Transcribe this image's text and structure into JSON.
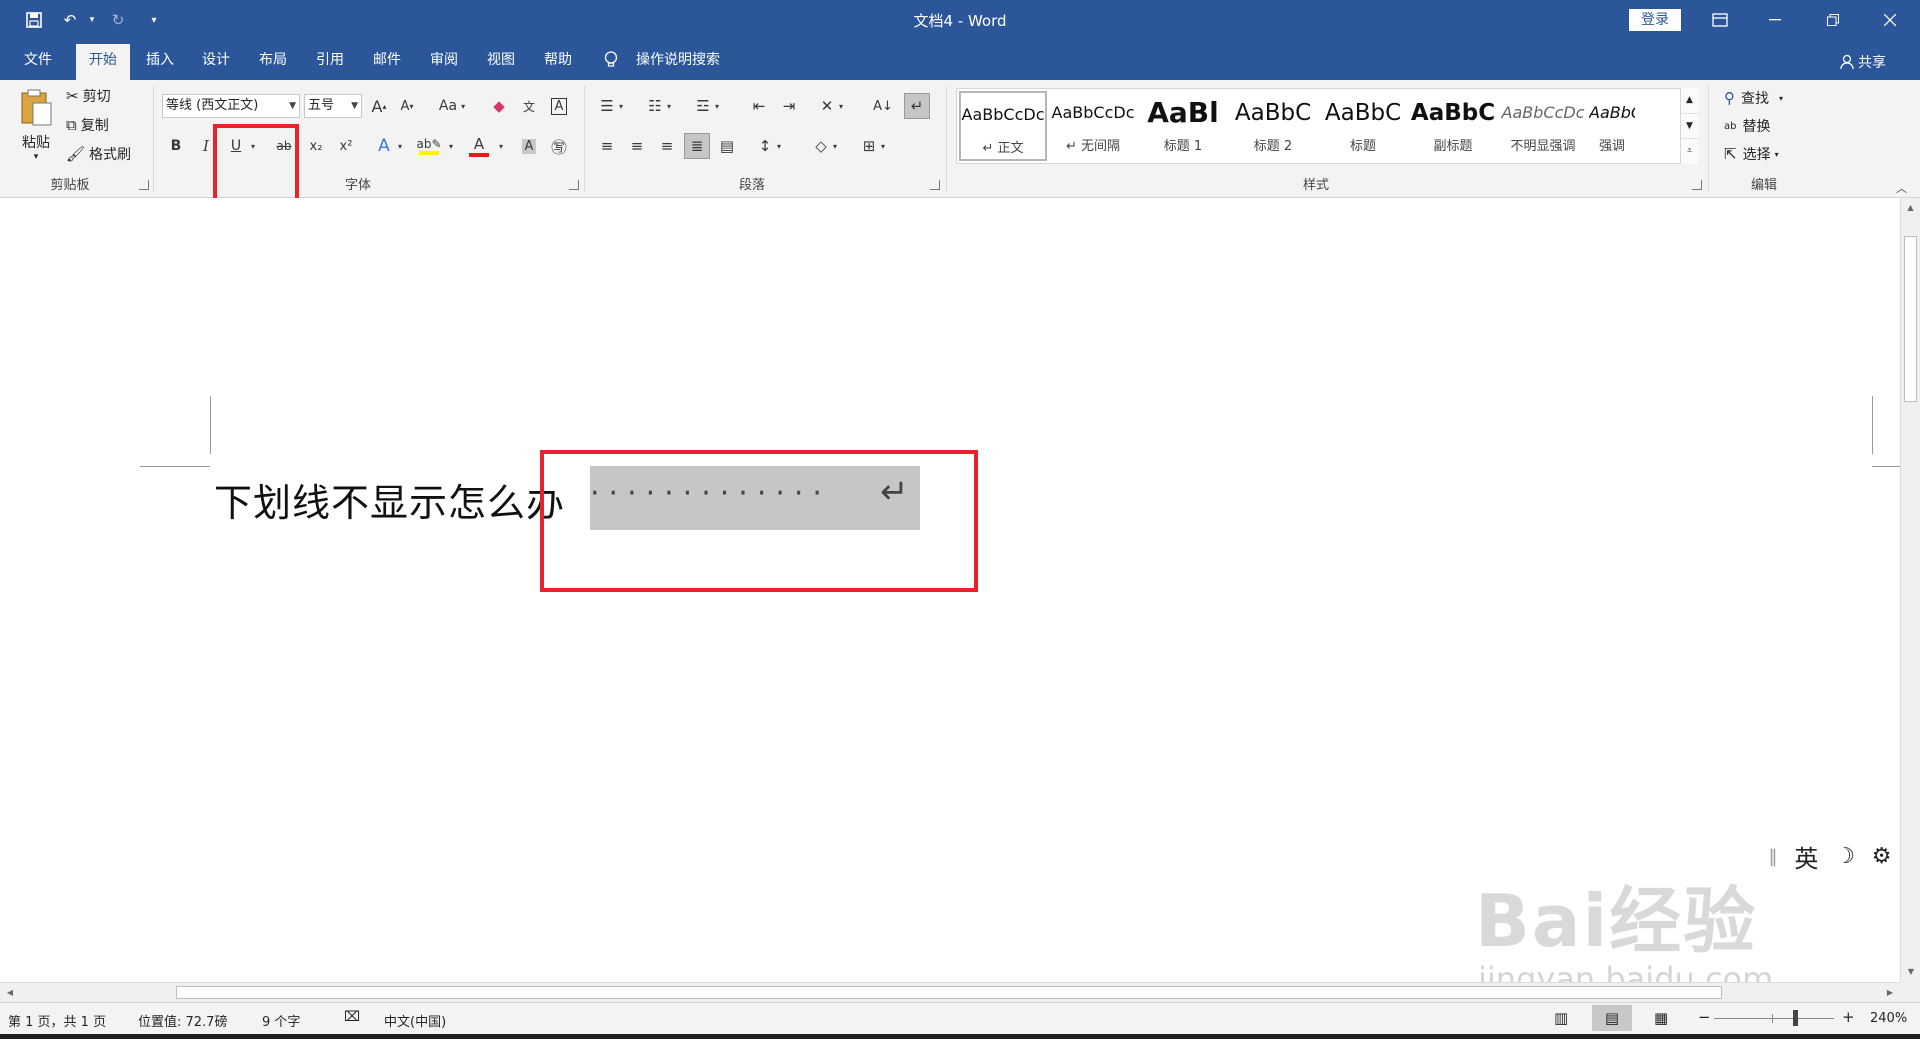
{
  "window": {
    "title": "文档4 - Word",
    "login_label": "登录",
    "share_label": "共享"
  },
  "quick_access": [
    "save-icon",
    "undo-icon",
    "redo-icon",
    "customize-icon"
  ],
  "tabs": [
    "文件",
    "开始",
    "插入",
    "设计",
    "布局",
    "引用",
    "邮件",
    "审阅",
    "视图",
    "帮助"
  ],
  "active_tab": "开始",
  "tell_me": "操作说明搜索",
  "clipboard": {
    "paste": "粘贴",
    "cut": "剪切",
    "copy": "复制",
    "format_painter": "格式刷",
    "label": "剪贴板"
  },
  "font": {
    "font_name": "等线 (西文正文)",
    "font_size": "五号",
    "label": "字体",
    "bold": "B",
    "italic": "I",
    "underline": "U",
    "strikethrough": "ab",
    "subscript": "x₂",
    "superscript": "x²",
    "grow": "A",
    "shrink": "A",
    "change_case": "Aa",
    "font_color_letter": "A"
  },
  "paragraph": {
    "label": "段落"
  },
  "styles": {
    "label": "样式",
    "items": [
      {
        "preview": "AaBbCcDc",
        "name": "↵ 正文"
      },
      {
        "preview": "AaBbCcDc",
        "name": "↵ 无间隔"
      },
      {
        "preview": "AaBl",
        "name": "标题 1"
      },
      {
        "preview": "AaBbC",
        "name": "标题 2"
      },
      {
        "preview": "AaBbC",
        "name": "标题"
      },
      {
        "preview": "AaBbC",
        "name": "副标题"
      },
      {
        "preview": "AaBbCcDc",
        "name": "不明显强调"
      },
      {
        "preview": "AaBbCcDc",
        "name": "强调"
      }
    ]
  },
  "editing": {
    "find": "查找",
    "replace": "替换",
    "select": "选择",
    "label": "编辑"
  },
  "document": {
    "text": "下划线不显示怎么办",
    "selected_placeholder": "·············",
    "paragraph_mark": "↵"
  },
  "ime": {
    "mode": "英"
  },
  "watermark": {
    "line1": "Bai经验",
    "line2": "jingyan.baidu.com"
  },
  "status": {
    "page": "第 1 页，共 1 页",
    "position": "位置值: 72.7磅",
    "words": "9 个字",
    "language": "中文(中国)",
    "zoom": "240%"
  },
  "colors": {
    "brand": "#2b579a",
    "highlight": "#c6c6c6",
    "annotation": "#e8232d",
    "font_color": "#e21b1b",
    "highlight_color": "#fff200"
  }
}
